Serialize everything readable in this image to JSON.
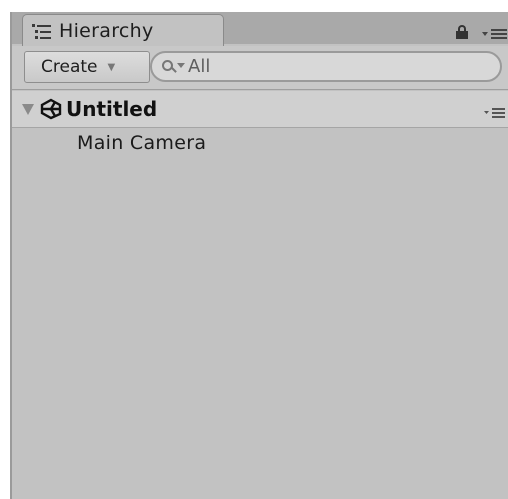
{
  "tab": {
    "label": "Hierarchy",
    "icon": "hierarchy-list-icon"
  },
  "toolbar": {
    "create_label": "Create",
    "search_placeholder": "All"
  },
  "scene": {
    "name": "Untitled",
    "expanded": true,
    "icon": "unity-logo-icon"
  },
  "items": [
    {
      "label": "Main Camera"
    }
  ],
  "colors": {
    "panel_bg": "#c2c2c2",
    "tabbar_bg": "#a9a9a9",
    "scene_row_bg": "#d0d0d0"
  }
}
